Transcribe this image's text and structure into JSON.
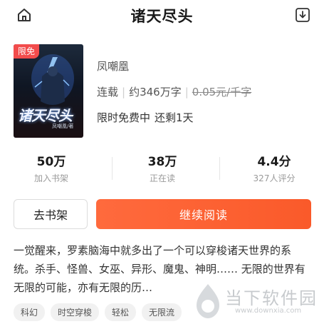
{
  "header": {
    "title": "诸天尽头",
    "home_icon": "home-icon",
    "download_icon": "download-icon"
  },
  "book": {
    "badge": "限免",
    "cover_title": "诸天尽头",
    "cover_author": "凤嘲凰/著",
    "author": "凤嘲凰",
    "status": "连载",
    "word_count": "约346万字",
    "price": "0.05元/千字",
    "promo_label": "限时免费中",
    "promo_remaining": "还剩1天"
  },
  "stats": [
    {
      "value": "50万",
      "label": "加入书架"
    },
    {
      "value": "38万",
      "label": "正在读"
    },
    {
      "value": "4.4分",
      "label": "327人评分"
    }
  ],
  "actions": {
    "shelf_label": "去书架",
    "read_label": "继续阅读"
  },
  "description": "一觉醒来，罗素脑海中就多出了一个可以穿梭诸天世界的系统。杀手、怪兽、女巫、异形、魔鬼、神明…… 无限的世界有无限的可能，亦有无限的历…",
  "tags": [
    "科幻",
    "时空穿梭",
    "轻松",
    "无限流"
  ],
  "watermark": {
    "brand": "当下软件园",
    "url": "www.downxia.com"
  },
  "colors": {
    "accent": "#fa5a2a",
    "badge": "#f24c4c"
  }
}
